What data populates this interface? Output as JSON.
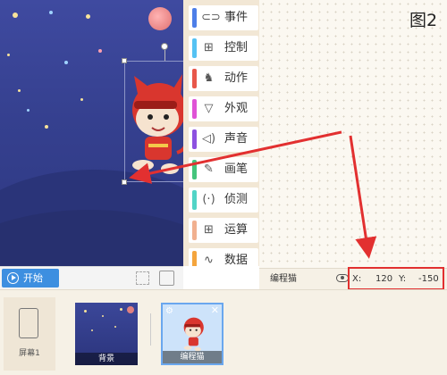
{
  "figure_label": "图2",
  "stage": {
    "start_button_label": "开始",
    "icons": {
      "play": "play-icon",
      "fullscreen": "fullscreen-icon",
      "small_stage": "small-stage-icon"
    }
  },
  "categories": [
    {
      "label": "事件",
      "color": "#4d7ee8",
      "icon": "toggle-icon",
      "glyph": "⊂⊃"
    },
    {
      "label": "控制",
      "color": "#55c2f3",
      "icon": "gamepad-icon",
      "glyph": "⊞"
    },
    {
      "label": "动作",
      "color": "#e8574a",
      "icon": "running-icon",
      "glyph": "♞"
    },
    {
      "label": "外观",
      "color": "#df53d6",
      "icon": "shirt-icon",
      "glyph": "▽"
    },
    {
      "label": "声音",
      "color": "#8d51e0",
      "icon": "speaker-icon",
      "glyph": "◁)"
    },
    {
      "label": "画笔",
      "color": "#44c47c",
      "icon": "pen-icon",
      "glyph": "✎"
    },
    {
      "label": "侦测",
      "color": "#51d4c6",
      "icon": "sensor-icon",
      "glyph": "(·)"
    },
    {
      "label": "运算",
      "color": "#f1b08f",
      "icon": "calculator-icon",
      "glyph": "⊞"
    },
    {
      "label": "数据",
      "color": "#f4a53d",
      "icon": "chart-line-icon",
      "glyph": "∿"
    }
  ],
  "sprite_info": {
    "name": "编程猫",
    "x_label": "X:",
    "x_value": "120",
    "y_label": "Y:",
    "y_value": "-150"
  },
  "library": {
    "screen_label": "屏幕1",
    "background_label": "背景",
    "sprite_label": "编程猫"
  },
  "colors": {
    "annotation": "#e23030",
    "start_button": "#3d8fe0"
  }
}
